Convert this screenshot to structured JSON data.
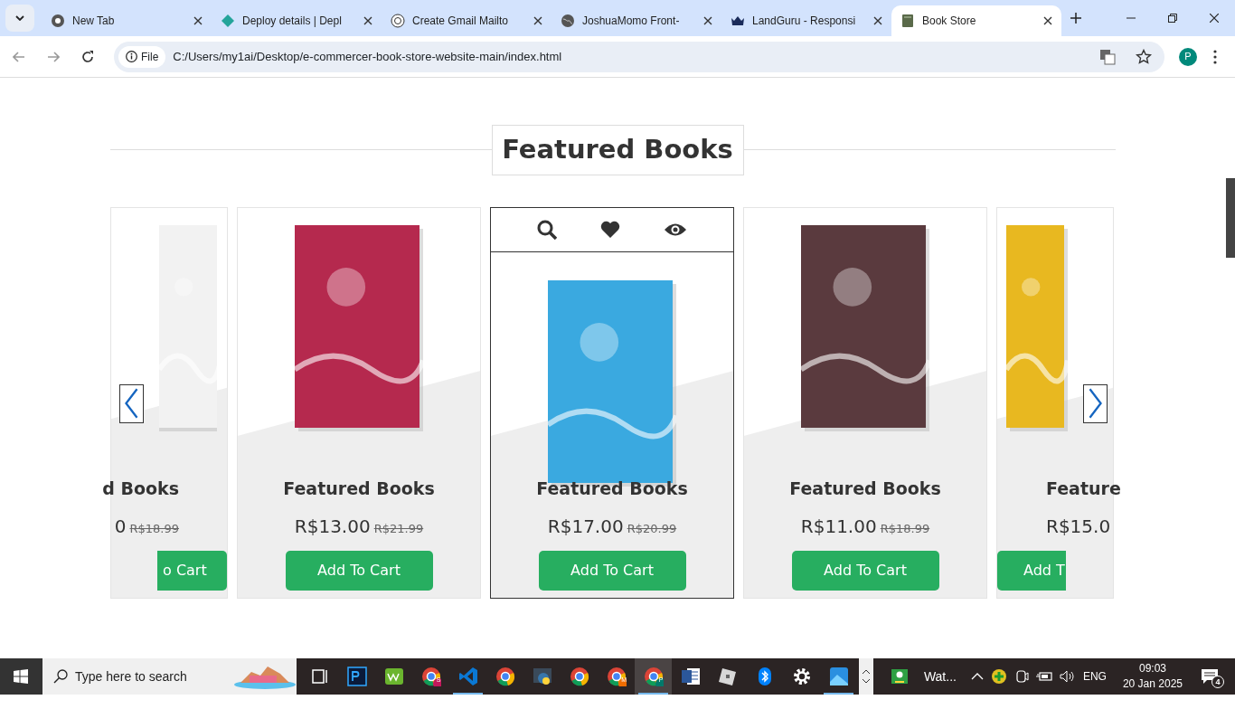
{
  "browser": {
    "tabs": [
      {
        "title": "New Tab",
        "selected": false
      },
      {
        "title": "Deploy details | Depl",
        "selected": false
      },
      {
        "title": "Create Gmail Mailto",
        "selected": false
      },
      {
        "title": "JoshuaMomo Front-",
        "selected": false
      },
      {
        "title": "LandGuru - Responsi",
        "selected": false
      },
      {
        "title": "Book Store",
        "selected": true
      }
    ],
    "address": {
      "chip": "File",
      "url": "C:/Users/my1ai/Desktop/e-commercer-book-store-website-main/index.html"
    },
    "profile": "P"
  },
  "page": {
    "heading": "Featured Books",
    "cards": [
      {
        "kind": "clipped-left",
        "title": "d Books",
        "price": "0",
        "old_price": "R$18.99",
        "button": "o Cart",
        "hovered": false,
        "color": "#f2f2f2"
      },
      {
        "kind": "full",
        "title": "Featured Books",
        "price": "R$13.00",
        "old_price": "R$21.99",
        "button": "Add To Cart",
        "hovered": false,
        "color": "#b5294e"
      },
      {
        "kind": "full",
        "title": "Featured Books",
        "price": "R$17.00",
        "old_price": "R$20.99",
        "button": "Add To Cart",
        "hovered": true,
        "color": "#3aa9e0"
      },
      {
        "kind": "full",
        "title": "Featured Books",
        "price": "R$11.00",
        "old_price": "R$18.99",
        "button": "Add To Cart",
        "hovered": false,
        "color": "#5a3a3e"
      },
      {
        "kind": "clipped-right",
        "title": "Feature",
        "price": "R$15.0",
        "button": "Add T",
        "hovered": false,
        "color": "#e8b820"
      }
    ]
  },
  "taskbar": {
    "search_placeholder": "Type here to search",
    "apps": [
      {
        "kind": "taskview",
        "running": false,
        "selected": false
      },
      {
        "kind": "photoshop",
        "running": false,
        "selected": false
      },
      {
        "kind": "w3",
        "running": false,
        "selected": false
      },
      {
        "kind": "chrome",
        "badge": "S",
        "running": false,
        "selected": false
      },
      {
        "kind": "vscode",
        "running": true,
        "selected": false
      },
      {
        "kind": "chrome",
        "running": false,
        "selected": false
      },
      {
        "kind": "python",
        "running": false,
        "selected": false
      },
      {
        "kind": "chrome",
        "running": false,
        "selected": false
      },
      {
        "kind": "chrome",
        "badge": "M",
        "running": false,
        "selected": false
      },
      {
        "kind": "chrome",
        "badge": "P",
        "running": true,
        "selected": true
      },
      {
        "kind": "word",
        "running": false,
        "selected": false
      },
      {
        "kind": "roblox",
        "running": false,
        "selected": false
      },
      {
        "kind": "bluetooth",
        "running": false,
        "selected": false
      },
      {
        "kind": "settings",
        "running": false,
        "selected": false
      },
      {
        "kind": "photos",
        "running": true,
        "selected": false
      }
    ],
    "widget": "Wat...",
    "language": "ENG",
    "time": "09:03",
    "date": "20 Jan 2025",
    "notifications": "4"
  }
}
